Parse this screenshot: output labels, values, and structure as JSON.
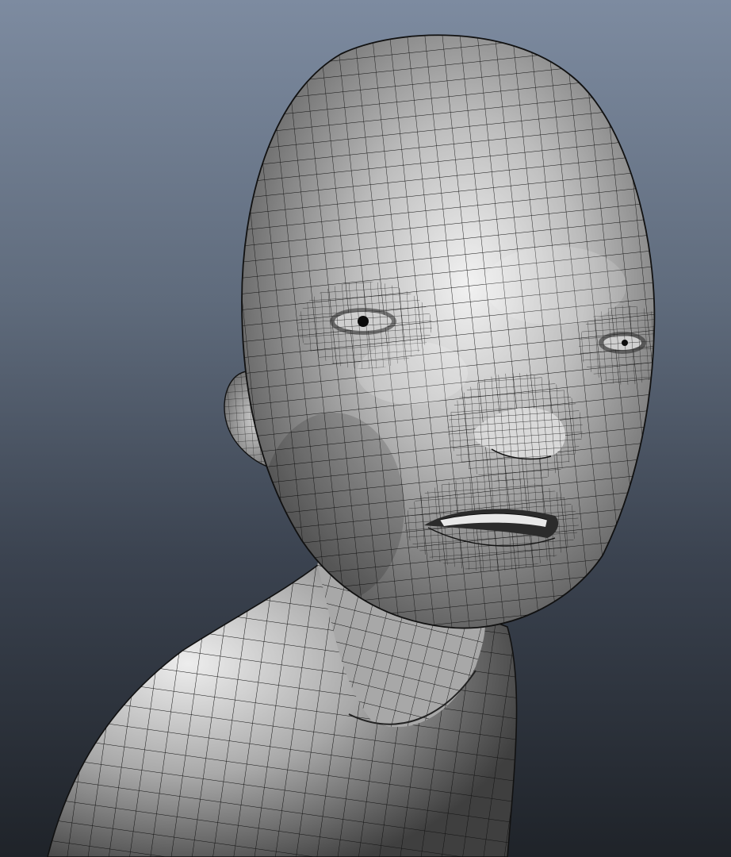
{
  "viewport": {
    "background_top": "#7d8ba0",
    "background_bottom": "#1f2329",
    "mesh_surface": "#bdbdbd",
    "mesh_highlight": "#f4f4f4",
    "mesh_shadow": "#565656",
    "wire_color": "#111111"
  },
  "model": {
    "shading_mode": "smooth-shade-with-wireframe"
  },
  "hud": {
    "label": ""
  }
}
